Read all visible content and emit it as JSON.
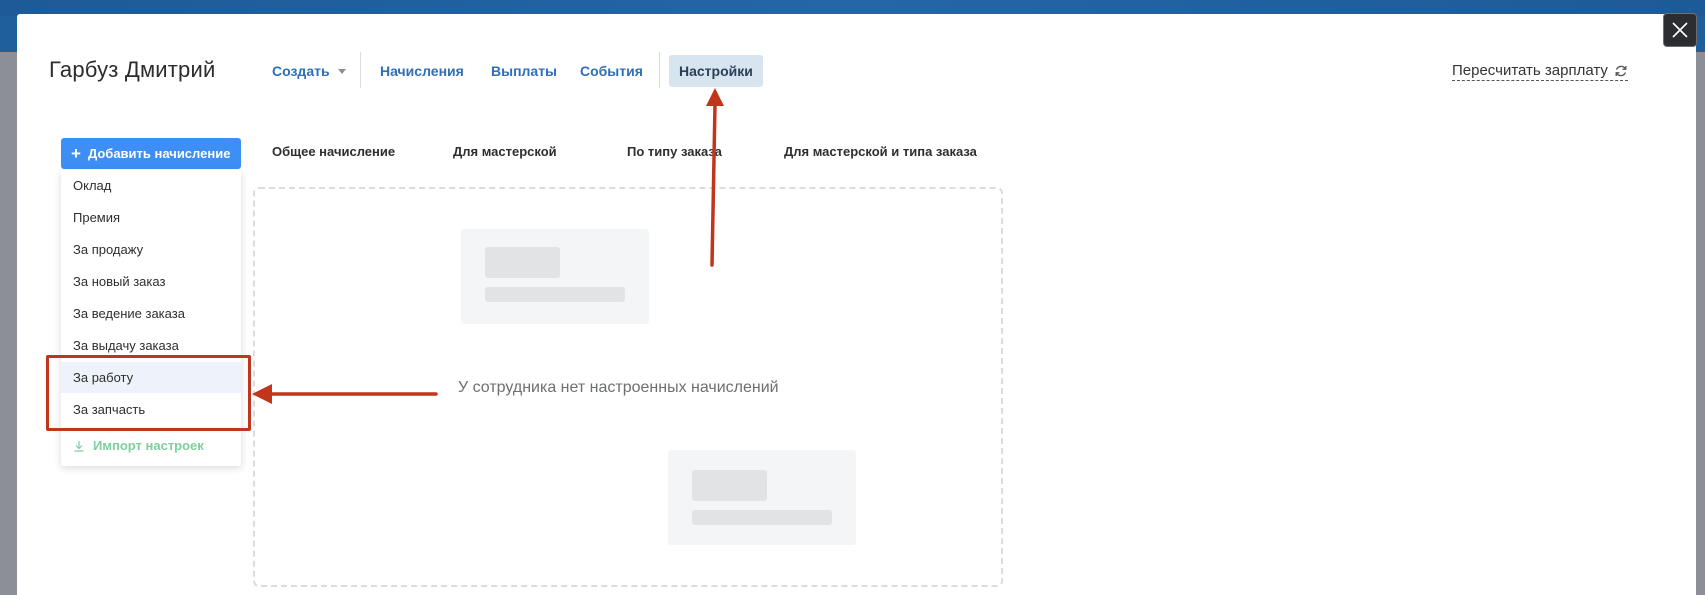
{
  "employee": {
    "name": "Гарбуз Дмитрий"
  },
  "nav": {
    "create": "Создать",
    "accruals": "Начисления",
    "payments": "Выплаты",
    "events": "События",
    "settings": "Настройки"
  },
  "recalc_label": "Пересчитать зарплату",
  "add_button": "Добавить начисление",
  "subtabs": [
    "Общее начисление",
    "Для мастерской",
    "По типу заказа",
    "Для мастерской и типа заказа"
  ],
  "dropdown": {
    "items": [
      "Оклад",
      "Премия",
      "За продажу",
      "За новый заказ",
      "За ведение заказа",
      "За выдачу заказа",
      "За работу",
      "За запчасть"
    ],
    "highlighted": "За работу",
    "import_label": "Импорт настроек"
  },
  "empty_message": "У сотрудника нет настроенных начислений",
  "colors": {
    "accent": "#3d8ef5",
    "nav_link": "#2f6fb5",
    "annotation": "#c0351c",
    "import_green": "#7fcf9e"
  },
  "icons": {
    "close": "close-icon",
    "refresh": "refresh-icon",
    "plus": "plus-icon",
    "download": "download-icon",
    "caret": "chevron-down-icon"
  }
}
